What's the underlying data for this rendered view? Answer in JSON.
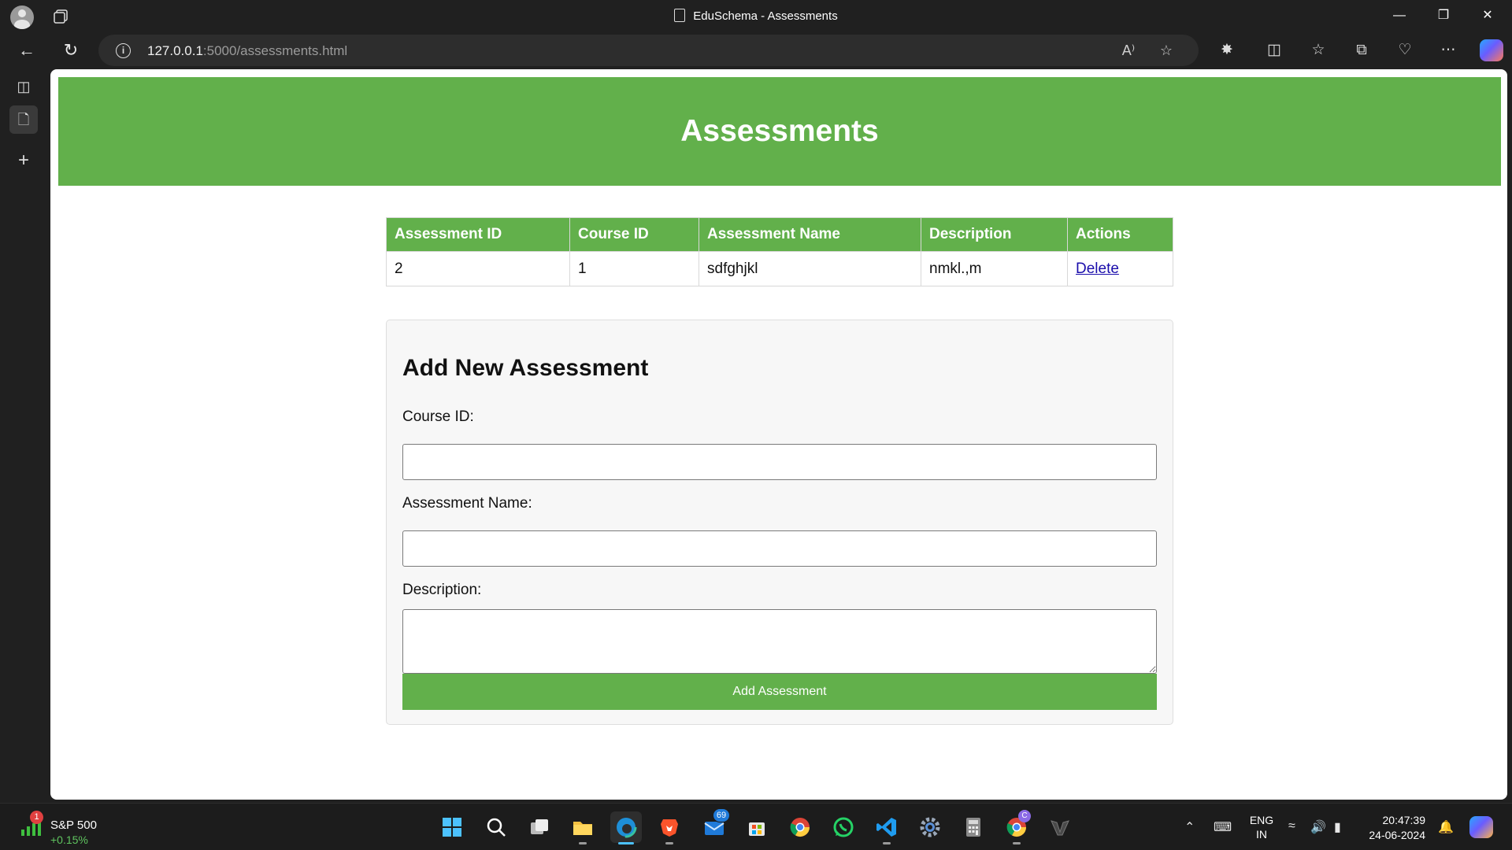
{
  "browser": {
    "tab_title": "EduSchema - Assessments",
    "url_host": "127.0.0.1",
    "url_path": ":5000/assessments.html"
  },
  "page": {
    "heading": "Assessments",
    "table": {
      "headers": [
        "Assessment ID",
        "Course ID",
        "Assessment Name",
        "Description",
        "Actions"
      ],
      "rows": [
        {
          "assessment_id": "2",
          "course_id": "1",
          "assessment_name": "sdfghjkl",
          "description": "nmkl.,m",
          "action": "Delete"
        }
      ]
    },
    "form": {
      "title": "Add New Assessment",
      "course_id_label": "Course ID:",
      "course_id_value": "",
      "assessment_name_label": "Assessment Name:",
      "assessment_name_value": "",
      "description_label": "Description:",
      "description_value": "",
      "submit_label": "Add Assessment"
    },
    "accent_color": "#62b04b"
  },
  "taskbar": {
    "widget_name": "S&P 500",
    "widget_change": "+0.15%",
    "widget_badge": "1",
    "mail_badge": "69",
    "chrome_badge": "C",
    "lang_line1": "ENG",
    "lang_line2": "IN",
    "time": "20:47:39",
    "date": "24-06-2024"
  }
}
